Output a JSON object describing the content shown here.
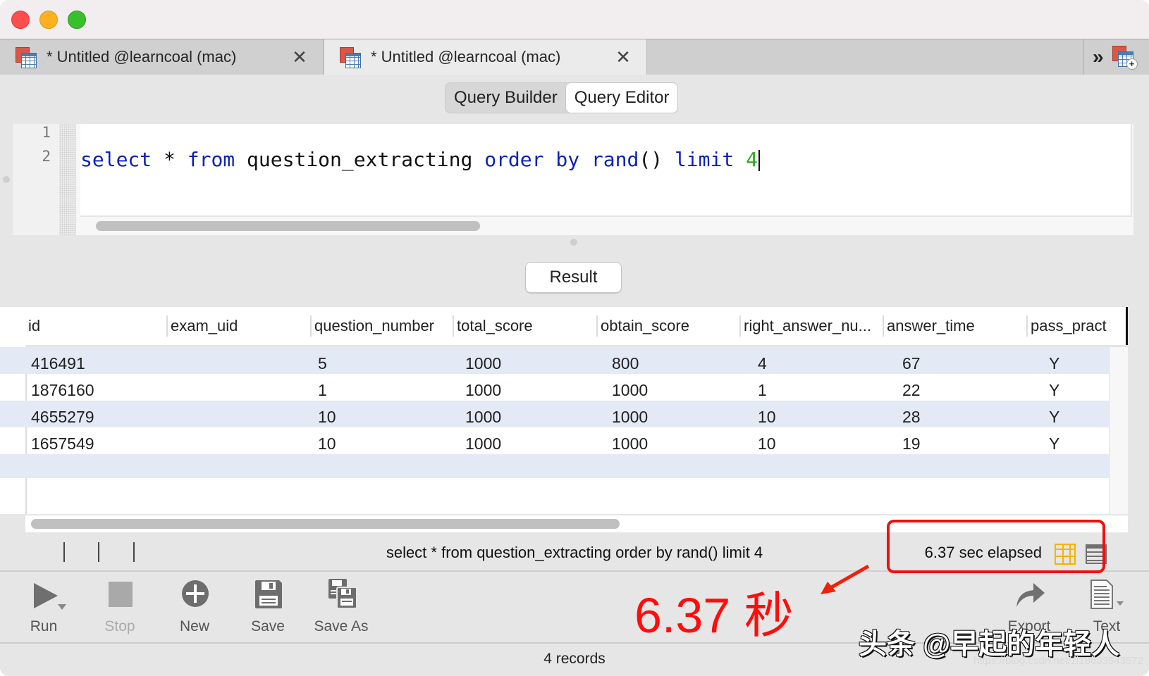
{
  "window": {
    "traffic_lights": [
      "close",
      "minimize",
      "zoom"
    ]
  },
  "tabs": [
    {
      "title": "* Untitled @learncoal (mac)",
      "active": false,
      "close_glyph": "✕"
    },
    {
      "title": "* Untitled @learncoal (mac)",
      "active": true,
      "close_glyph": "✕"
    }
  ],
  "tab_overflow": {
    "chevron_glyph": "»",
    "new_tab_icon": "new-query-icon"
  },
  "mode_switch": {
    "options": [
      "Query Builder",
      "Query Editor"
    ],
    "selected": "Query Editor"
  },
  "editor": {
    "line_numbers": [
      "1",
      "2"
    ],
    "lines": [
      "",
      "select * from question_extracting order by rand() limit 4"
    ],
    "tokens": {
      "select": "select",
      "star": " * ",
      "from": "from",
      "table": " question_extracting ",
      "order": "order",
      "by": "by",
      "rand": "rand",
      "parens": "()",
      "limit": "limit",
      "limit_value": "4"
    }
  },
  "result_button": {
    "label": "Result"
  },
  "results": {
    "columns": [
      "id",
      "exam_uid",
      "question_number",
      "total_score",
      "obtain_score",
      "right_answer_nu...",
      "answer_time",
      "pass_pract"
    ],
    "rows": [
      [
        "416491",
        "",
        "5",
        "1000",
        "800",
        "4",
        "67",
        "Y"
      ],
      [
        "1876160",
        "",
        "1",
        "1000",
        "1000",
        "1",
        "22",
        "Y"
      ],
      [
        "4655279",
        "",
        "10",
        "1000",
        "1000",
        "10",
        "28",
        "Y"
      ],
      [
        "1657549",
        "",
        "10",
        "1000",
        "1000",
        "10",
        "19",
        "Y"
      ]
    ]
  },
  "status_bar": {
    "query_text": "select * from question_extracting order by rand() limit 4",
    "elapsed": "6.37 sec elapsed"
  },
  "toolbar": {
    "run": "Run",
    "stop": "Stop",
    "new": "New",
    "save": "Save",
    "save_as": "Save As",
    "export": "Export",
    "text": "Text"
  },
  "footer": {
    "records": "4 records"
  },
  "annotation": {
    "text": "6.37 秒",
    "color": "#ff0c0c"
  },
  "watermark": {
    "text": "头条 @早起的年轻人",
    "url": "https://blog.csdn.net/zl18603543572"
  },
  "colors": {
    "keyword": "#0a22b8",
    "number": "#2ea620",
    "row_alt": "#e4e9f6",
    "grid_icon": "#f5b400"
  }
}
